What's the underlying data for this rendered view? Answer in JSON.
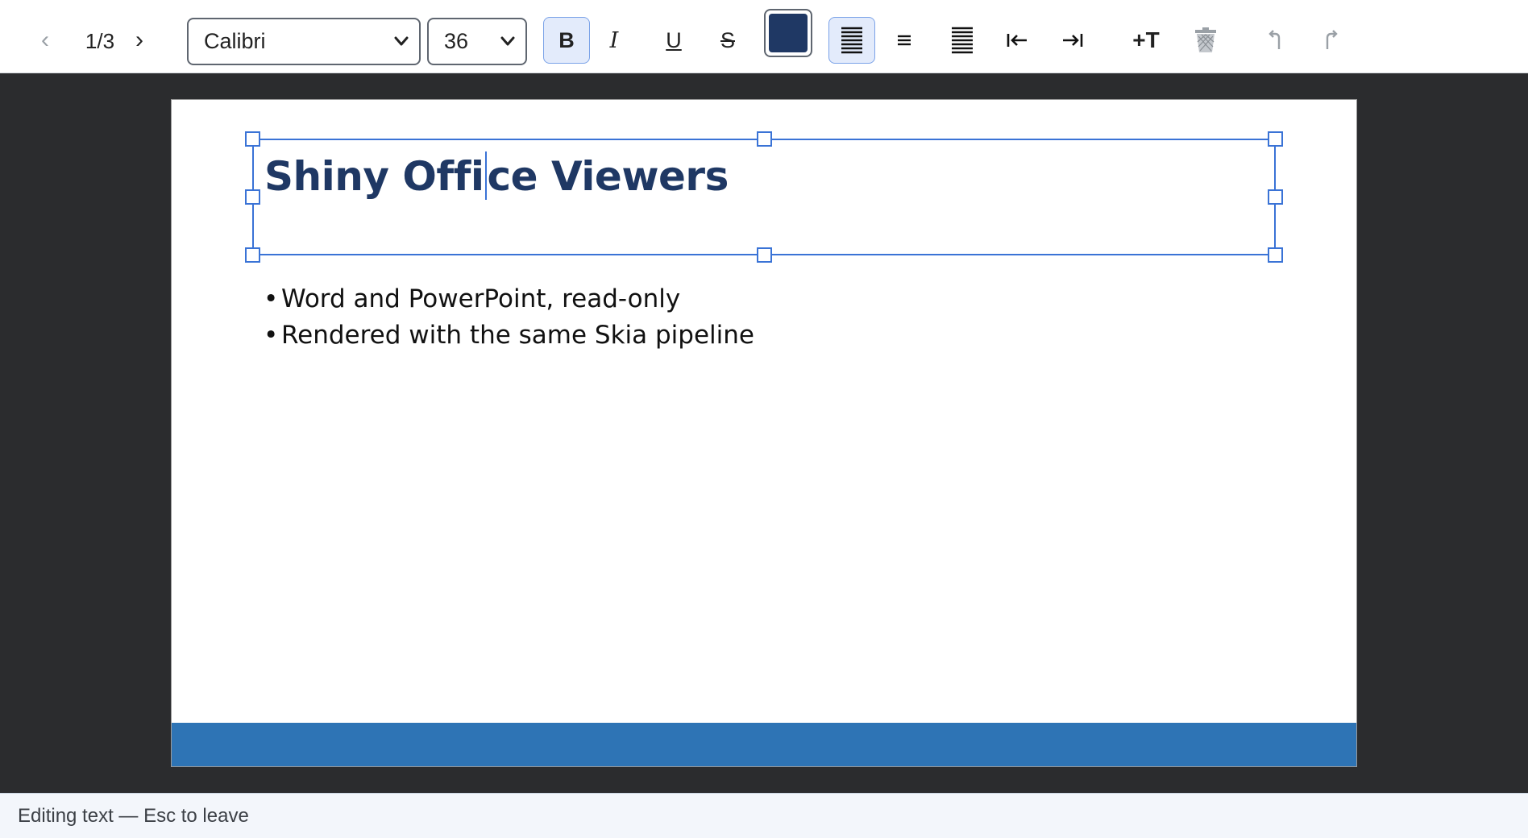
{
  "toolbar": {
    "prev_glyph": "‹",
    "next_glyph": "›",
    "page_indicator": "1/3",
    "font_family": "Calibri",
    "font_size": "36",
    "bold_label": "B",
    "italic_label": "I",
    "underline_label": "U",
    "strike_label": "S",
    "text_color": "#1f3864",
    "align_left_icon": "align-left-icon",
    "align_center_icon": "align-center-icon",
    "justify_icon": "justify-icon",
    "outdent_icon": "outdent-icon",
    "indent_icon": "indent-icon",
    "add_text_label": "+T",
    "delete_icon": "trash-icon",
    "undo_icon": "undo-icon",
    "redo_icon": "redo-icon"
  },
  "slide": {
    "title_before_caret": "Shiny Offi",
    "title_after_caret": "ce Viewers",
    "title_color": "#1f3864",
    "bullets": [
      "Word and PowerPoint, read-only",
      "Rendered with the same Skia pipeline"
    ],
    "bullet_glyph": "•",
    "band_color": "#2e74b5"
  },
  "status": {
    "text": "Editing text — Esc to leave"
  }
}
